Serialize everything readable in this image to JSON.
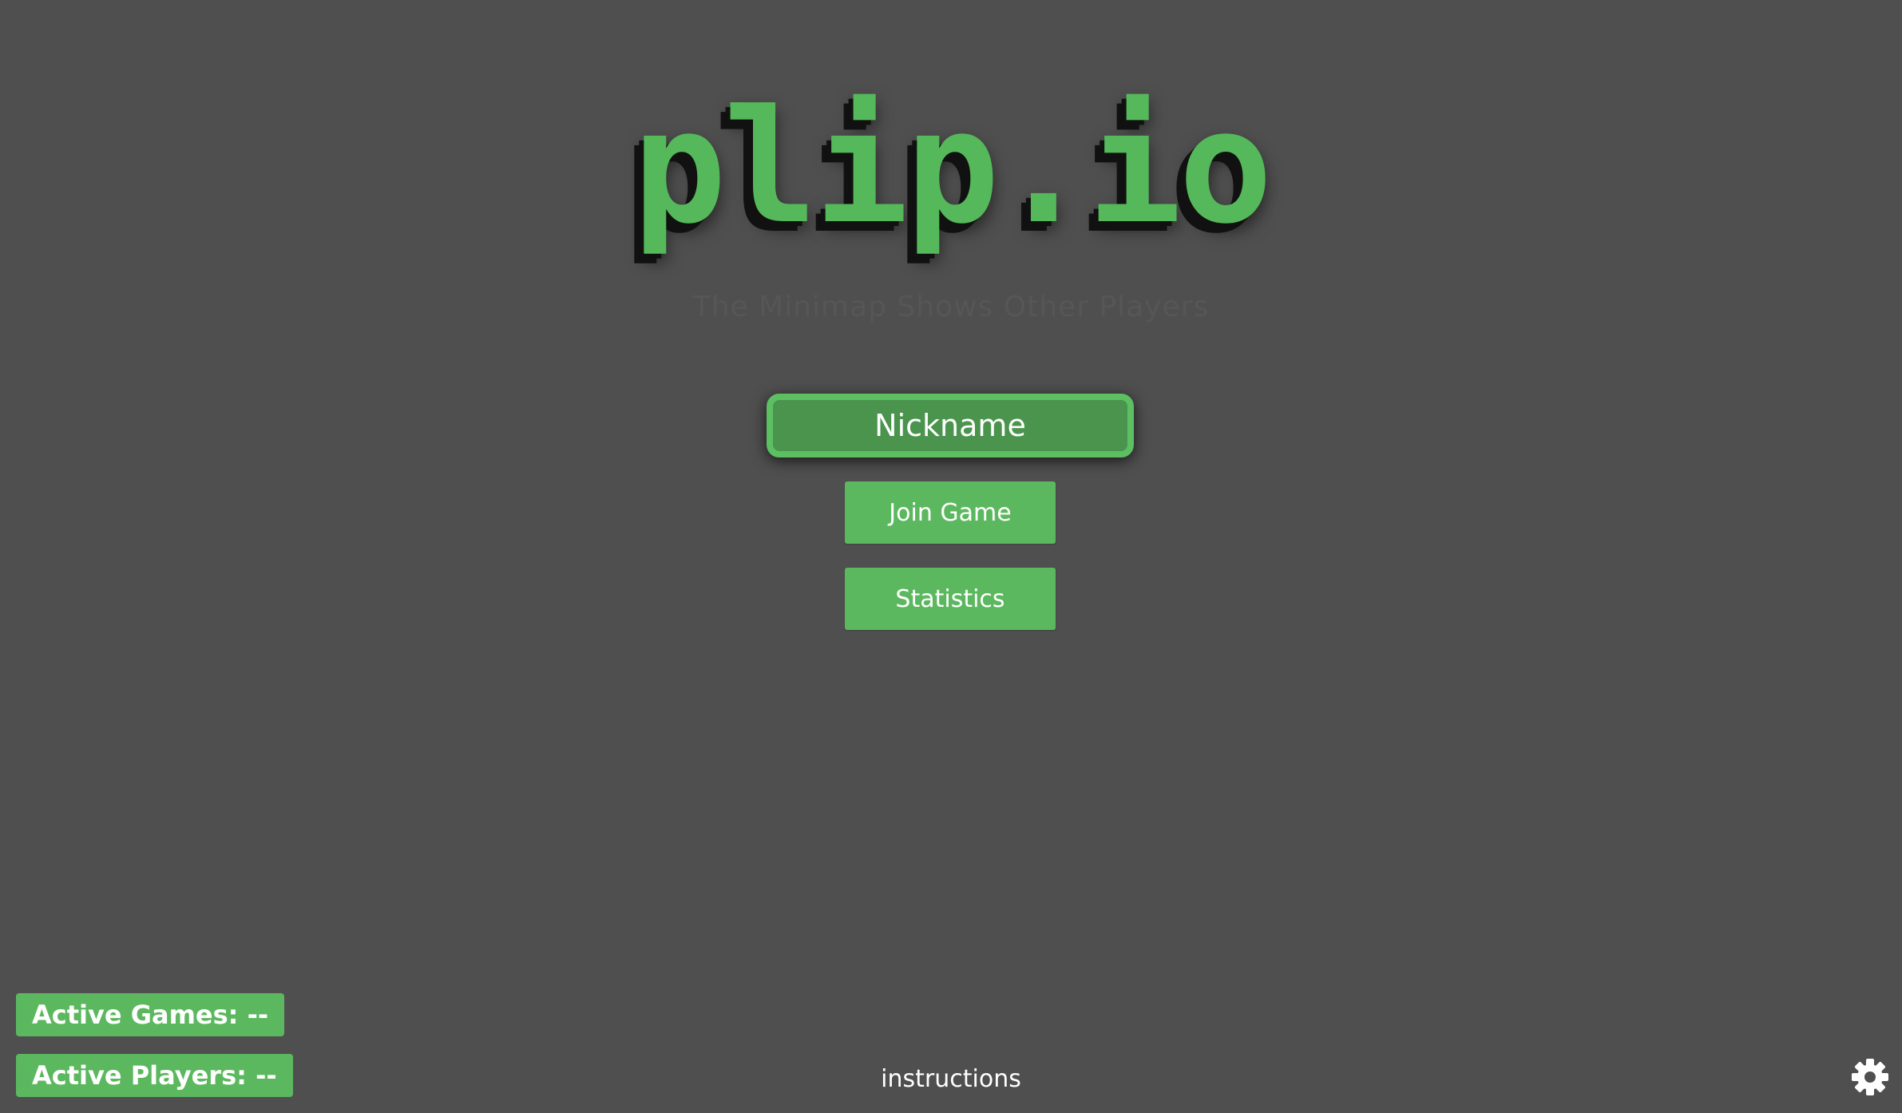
{
  "logo": {
    "text": "plip.io"
  },
  "tip": {
    "text": "The Minimap Shows Other Players"
  },
  "nickname": {
    "placeholder": "Nickname",
    "value": ""
  },
  "buttons": {
    "join_label": "Join Game",
    "statistics_label": "Statistics"
  },
  "stats": {
    "active_games": "Active Games: --",
    "active_players": "Active Players: --"
  },
  "footer": {
    "instructions_label": "instructions"
  },
  "icons": {
    "settings": "gear-icon"
  },
  "colors": {
    "background": "#4f4f4f",
    "accent_green": "#5cb85f",
    "input_fill": "#4a944e",
    "input_border": "#5cc063"
  }
}
